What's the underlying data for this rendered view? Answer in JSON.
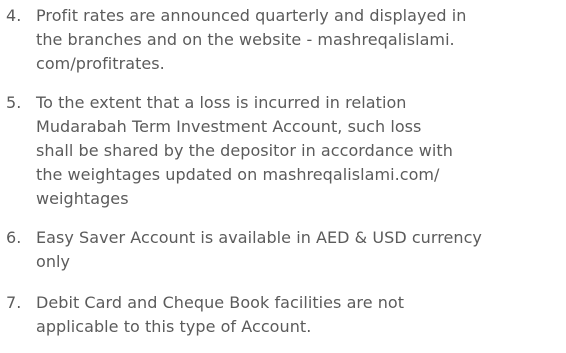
{
  "document": {
    "items": [
      {
        "number": "4.",
        "lines": [
          "Profit rates are announced quarterly and displayed in",
          "the branches and on the website - mashreqalislami.",
          "com/profitrates."
        ]
      },
      {
        "number": "5.",
        "lines": [
          "To the extent that a loss is incurred in relation",
          "Mudarabah Term Investment Account, such loss",
          "shall be shared by the depositor in accordance with",
          "the weightages updated on mashreqalislami.com/",
          "weightages"
        ]
      },
      {
        "number": "6.",
        "lines": [
          "Easy Saver Account is available in AED & USD currency",
          "only"
        ]
      },
      {
        "number": "7.",
        "lines": [
          "Debit Card and Cheque Book facilities are not",
          "applicable to this type of Account."
        ]
      }
    ]
  }
}
